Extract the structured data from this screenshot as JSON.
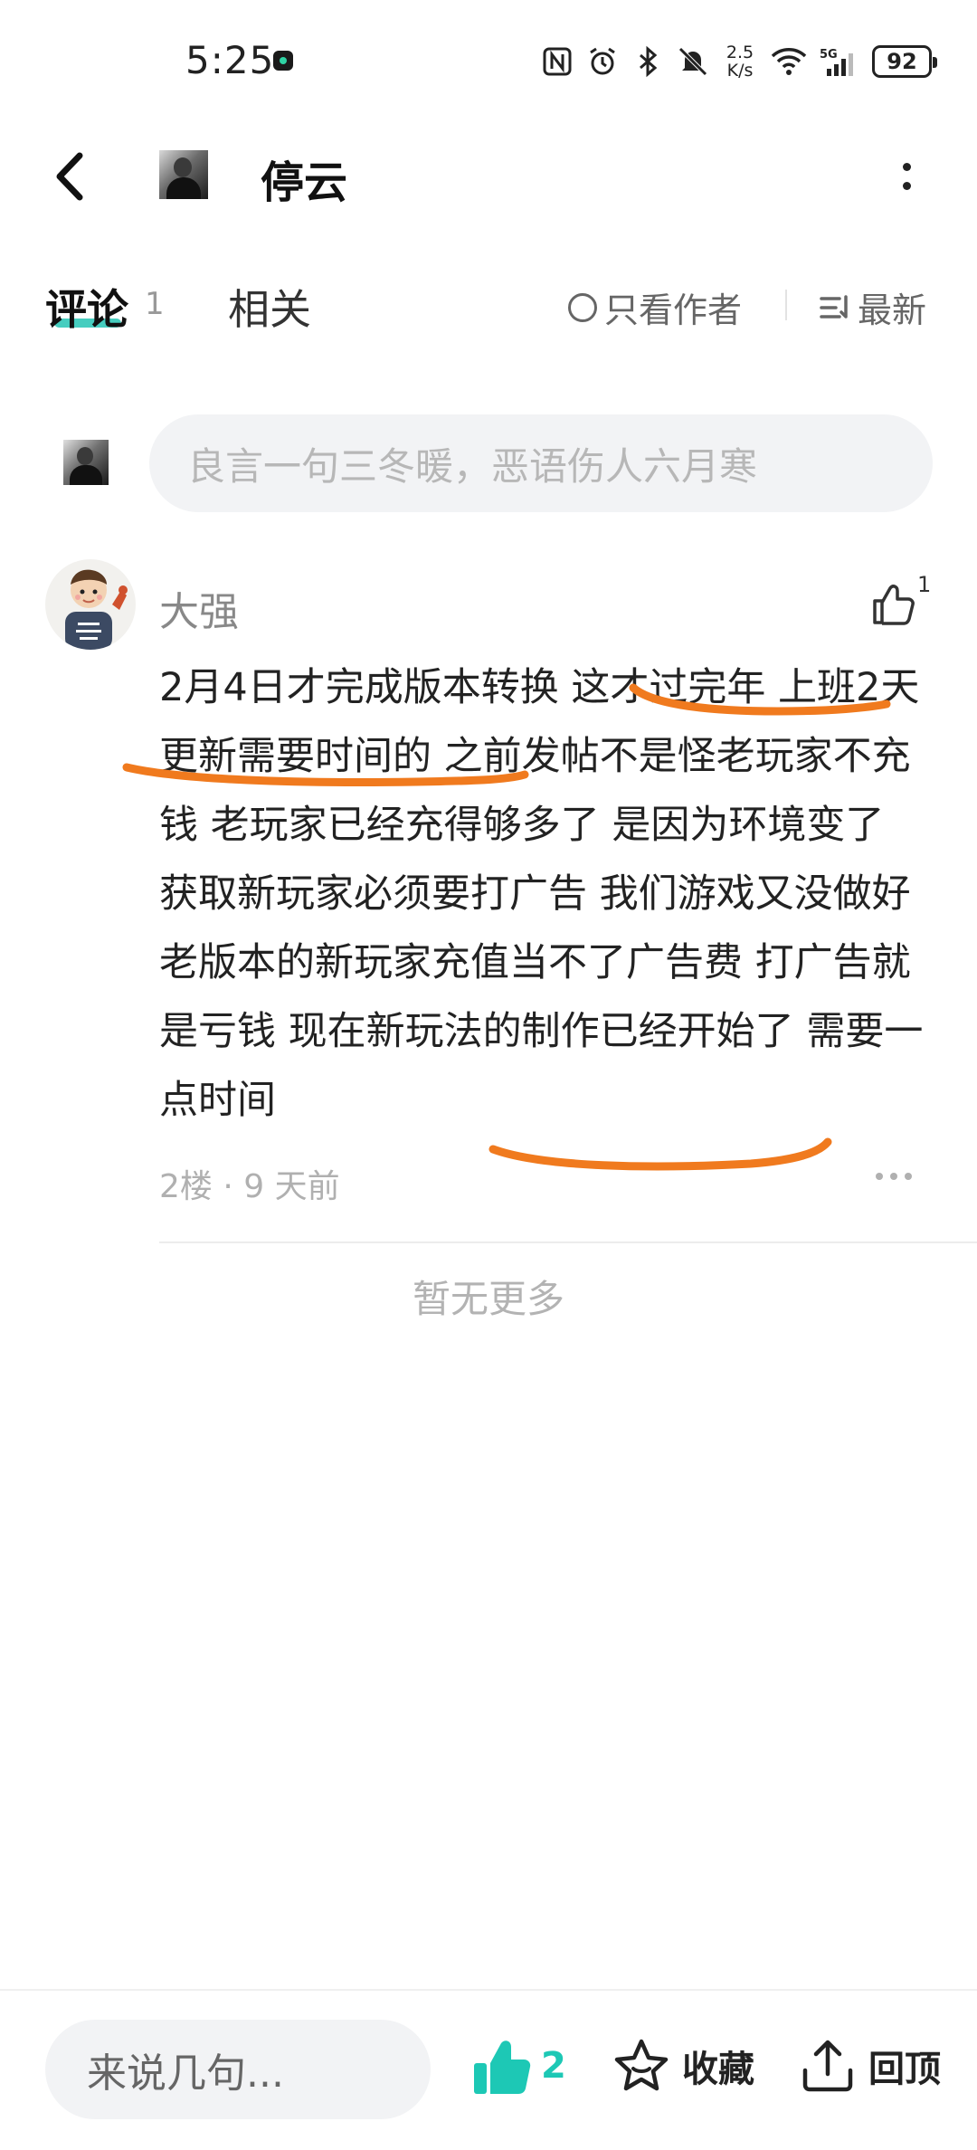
{
  "status_bar": {
    "time": "5:25",
    "net_speed_value": "2.5",
    "net_speed_unit": "K/s",
    "battery": "92",
    "icons": [
      "nfc-icon",
      "alarm-icon",
      "bluetooth-icon",
      "mute-icon",
      "wifi-icon",
      "signal-5g-icon"
    ]
  },
  "header": {
    "title": "停云"
  },
  "tabs": {
    "comments_label": "评论",
    "comments_count": "1",
    "related_label": "相关",
    "author_only_label": "只看作者",
    "sort_label": "最新"
  },
  "comment_input": {
    "placeholder": "良言一句三冬暖，恶语伤人六月寒"
  },
  "comments": [
    {
      "username": "大强",
      "likes": "1",
      "body": "2月4日才完成版本转换 这才过完年 上班2天 更新需要时间的 之前发帖不是怪老玩家不充钱 老玩家已经充得够多了 是因为环境变了  获取新玩家必须要打广告 我们游戏又没做好 老版本的新玩家充值当不了广告费 打广告就是亏钱 现在新玩法的制作已经开始了 需要一点时间",
      "meta": "2楼 · 9 天前"
    }
  ],
  "list_end_text": "暂无更多",
  "bottom_bar": {
    "reply_placeholder": "来说几句...",
    "like_count": "2",
    "favorite_label": "收藏",
    "back_to_top_label": "回顶"
  },
  "colors": {
    "accent": "#1dc8b5",
    "annotation": "#f07a1e"
  }
}
